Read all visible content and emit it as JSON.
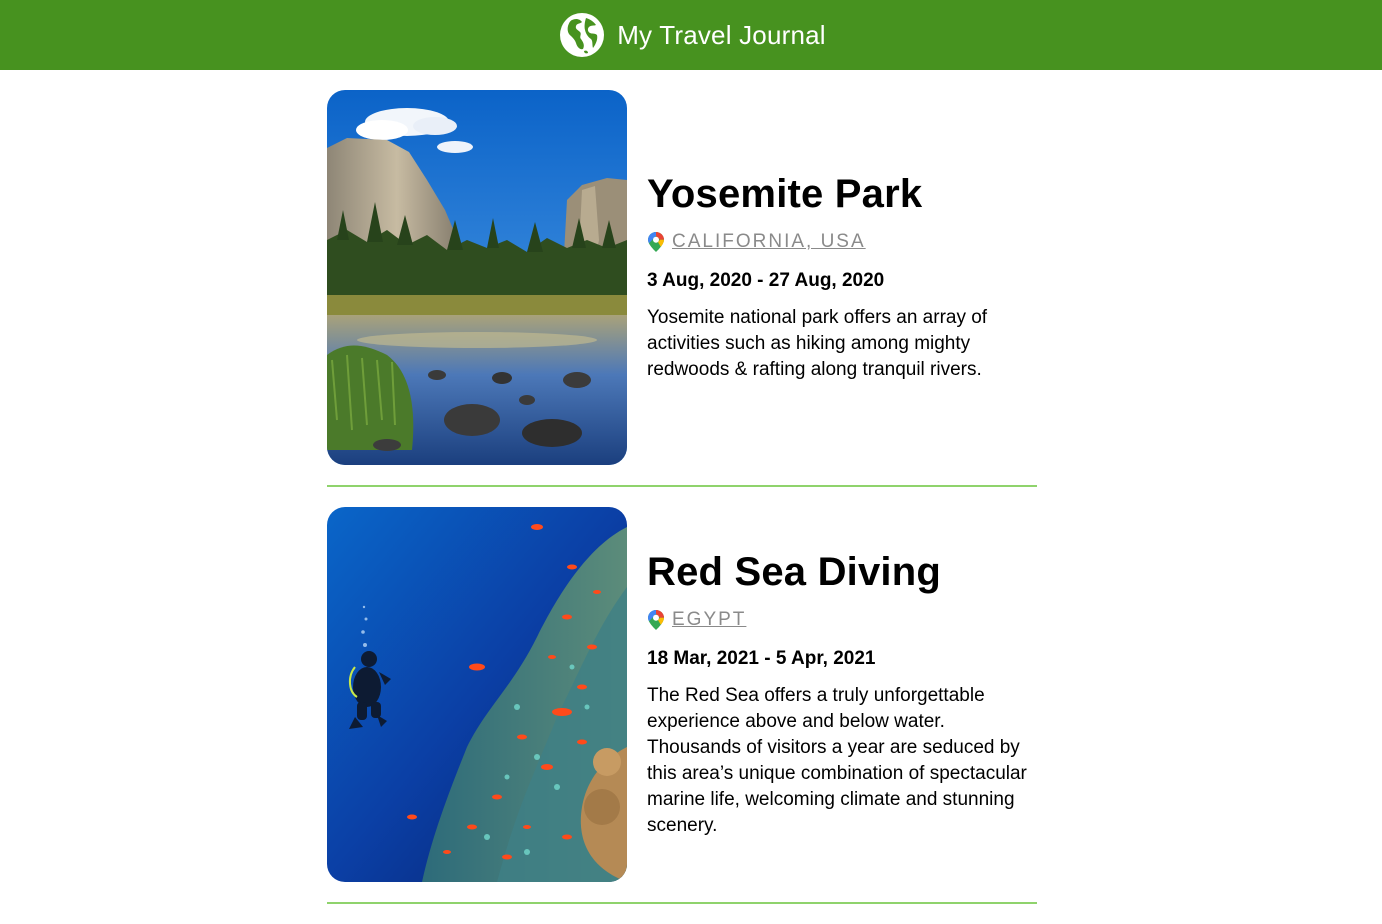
{
  "header": {
    "title": "My Travel Journal",
    "logo_icon": "globe-icon",
    "background": "#47921f"
  },
  "entries": [
    {
      "title": "Yosemite Park",
      "location": "California, USA",
      "location_icon": "map-pin-icon",
      "dates": "3 Aug, 2020 - 27 Aug, 2020",
      "description": "Yosemite national park offers an array of activities such as hiking among mighty redwoods & rafting along tranquil rivers.",
      "photo": "yosemite-valley-photo"
    },
    {
      "title": "Red Sea Diving",
      "location": "Egypt",
      "location_icon": "map-pin-icon",
      "dates": "18 Mar, 2021 - 5 Apr, 2021",
      "description": "The Red Sea offers a truly unforgettable experience above and below water. Thousands of visitors a year are seduced by this area’s unique combination of spectacular marine life, welcoming climate and stunning scenery.",
      "photo": "red-sea-reef-diver-photo"
    }
  ],
  "colors": {
    "accent": "#47921f",
    "divider": "#8fd36c",
    "location_text": "#8a8a8a"
  }
}
